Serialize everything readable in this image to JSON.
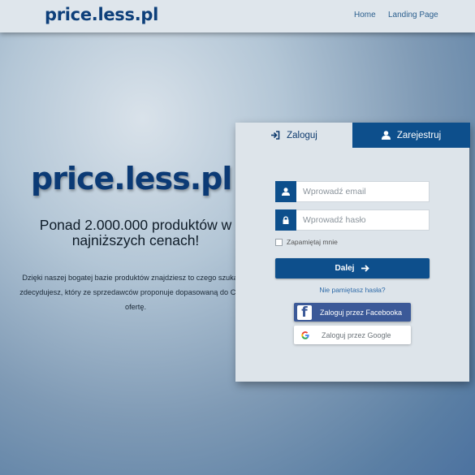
{
  "nav": {
    "brand": "price.less.pl",
    "links": [
      {
        "label": "Home"
      },
      {
        "label": "Landing Page"
      }
    ]
  },
  "hero": {
    "title": "price.less.pl",
    "subtitle": "Ponad 2.000.000 produktów w najniższych cenach!",
    "description": "Dzięki naszej bogatej bazie produktów znajdziesz to czego szukasz i zdecydujesz, który ze sprzedawców proponuje dopasowaną do Ciebie ofertę."
  },
  "auth": {
    "tabs": [
      {
        "label": "Zaloguj",
        "icon": "sign-in-icon",
        "active": true
      },
      {
        "label": "Zarejestruj",
        "icon": "user-icon",
        "active": false
      }
    ],
    "email": {
      "placeholder": "Wprowadź email",
      "value": "",
      "icon": "user-icon"
    },
    "password": {
      "placeholder": "Wprowadź hasło",
      "value": "",
      "icon": "lock-icon"
    },
    "remember_label": "Zapamiętaj mnie",
    "submit_label": "Dalej",
    "forgot_label": "Nie pamiętasz hasła?",
    "facebook_label": "Zaloguj przez Facebooka",
    "google_label": "Zaloguj przez Google"
  },
  "colors": {
    "primary": "#0d4f8c",
    "brand_text": "#0d3f7a",
    "facebook": "#3b5998",
    "card_bg": "#dde4ea"
  }
}
